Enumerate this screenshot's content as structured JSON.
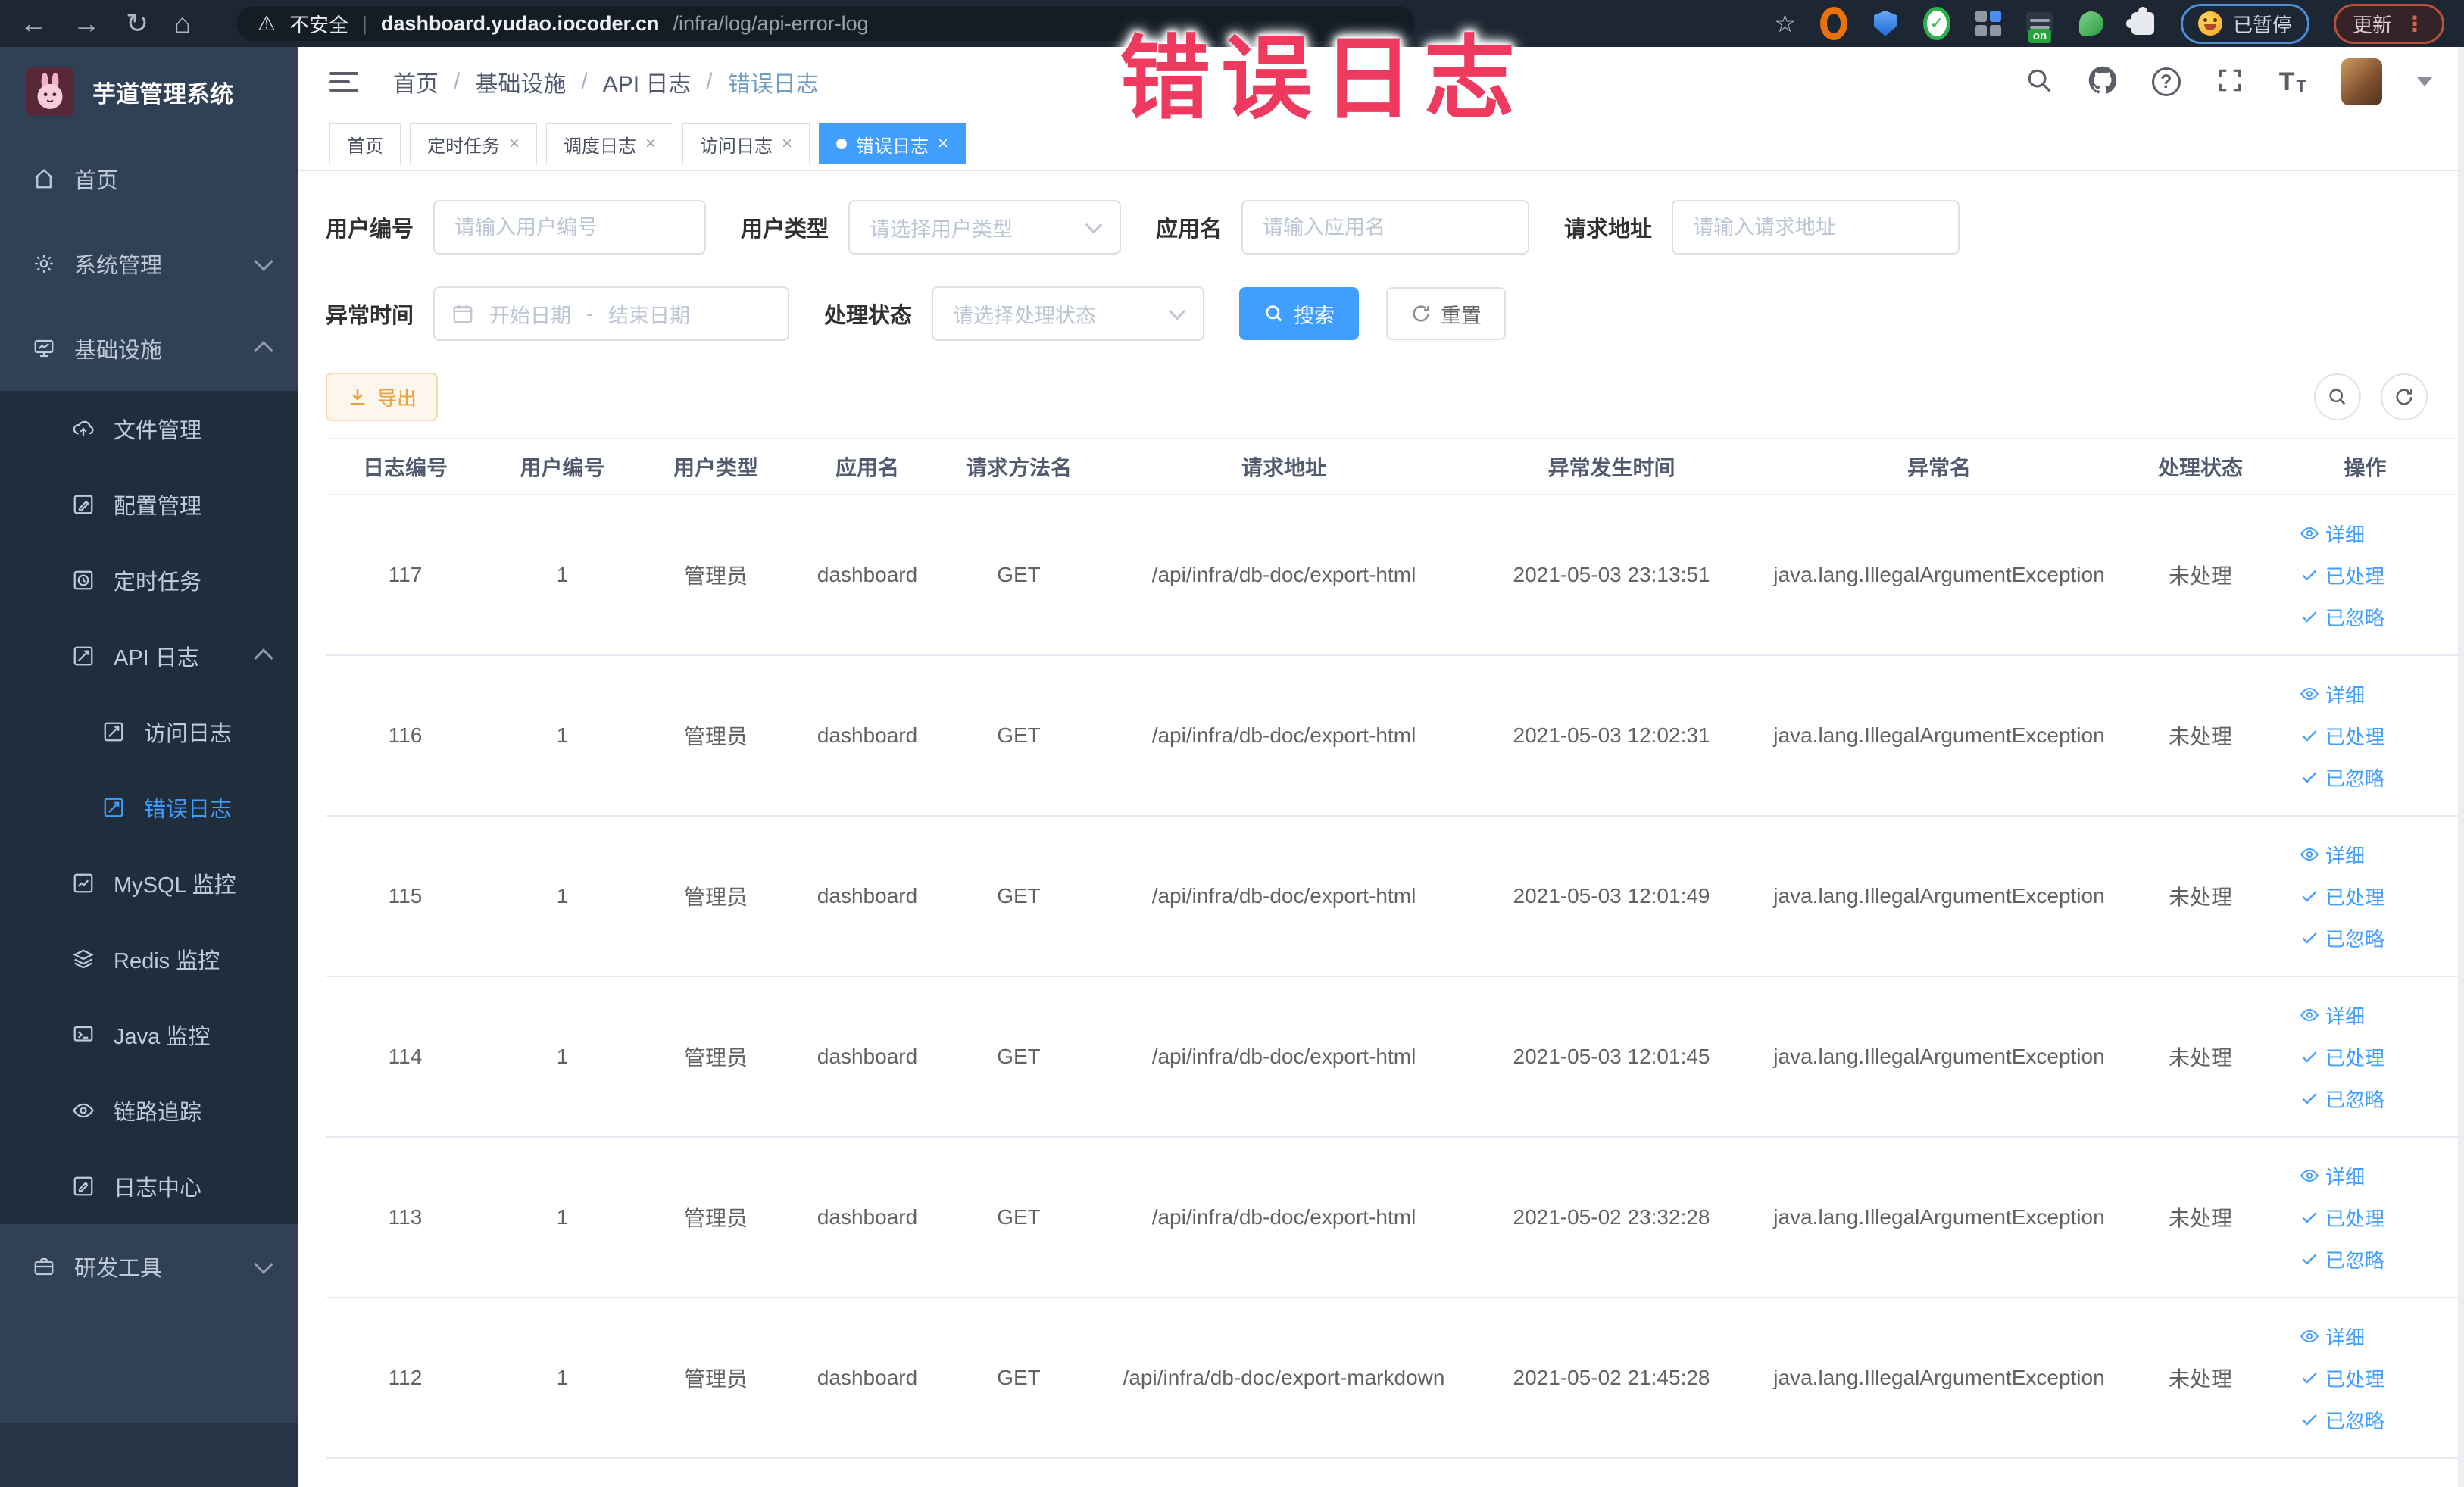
{
  "browser": {
    "security_label": "不安全",
    "url_domain": "dashboard.yudao.iocoder.cn",
    "url_path": "/infra/log/api-error-log",
    "paused_badge": "已暂停",
    "update_label": "更新"
  },
  "overlay_title": "错误日志",
  "ui": {
    "breadcrumb_separator": "/",
    "close_glyph": "×",
    "back_glyph": "←",
    "forward_glyph": "→",
    "reload_glyph": "↻",
    "home_glyph": "⌂",
    "warning_glyph": "⚠",
    "divider_glyph": "|",
    "star_glyph": "☆",
    "kebab_glyph": "⋮",
    "check_glyph": "✓",
    "help_glyph": "?"
  },
  "sidebar": {
    "logo_title": "芋道管理系统",
    "items": {
      "home": "首页",
      "system": "系统管理",
      "infra": "基础设施",
      "file": "文件管理",
      "config": "配置管理",
      "job": "定时任务",
      "apilog": "API 日志",
      "accesslog": "访问日志",
      "errorlog": "错误日志",
      "mysql": "MySQL 监控",
      "redis": "Redis 监控",
      "java": "Java 监控",
      "trace": "链路追踪",
      "logcenter": "日志中心",
      "devtools": "研发工具"
    }
  },
  "breadcrumb": {
    "items": [
      "首页",
      "基础设施",
      "API 日志",
      "错误日志"
    ]
  },
  "tabs": [
    {
      "label": "首页",
      "closable": false,
      "active": false
    },
    {
      "label": "定时任务",
      "closable": true,
      "active": false
    },
    {
      "label": "调度日志",
      "closable": true,
      "active": false
    },
    {
      "label": "访问日志",
      "closable": true,
      "active": false
    },
    {
      "label": "错误日志",
      "closable": true,
      "active": true
    }
  ],
  "filters": {
    "user_id_label": "用户编号",
    "user_id_placeholder": "请输入用户编号",
    "user_type_label": "用户类型",
    "user_type_placeholder": "请选择用户类型",
    "app_name_label": "应用名",
    "app_name_placeholder": "请输入应用名",
    "request_url_label": "请求地址",
    "request_url_placeholder": "请输入请求地址",
    "exception_time_label": "异常时间",
    "date_start_placeholder": "开始日期",
    "date_separator": "-",
    "date_end_placeholder": "结束日期",
    "process_status_label": "处理状态",
    "process_status_placeholder": "请选择处理状态",
    "search_label": "搜索",
    "reset_label": "重置"
  },
  "toolbar": {
    "export_label": "导出"
  },
  "table": {
    "columns": [
      "日志编号",
      "用户编号",
      "用户类型",
      "应用名",
      "请求方法名",
      "请求地址",
      "异常发生时间",
      "异常名",
      "处理状态",
      "操作"
    ],
    "actions": {
      "detail": "详细",
      "processed": "已处理",
      "ignored": "已忽略"
    },
    "rows": [
      {
        "id": "117",
        "user_id": "1",
        "user_type": "管理员",
        "app": "dashboard",
        "method": "GET",
        "url": "/api/infra/db-doc/export-html",
        "time": "2021-05-03 23:13:51",
        "exception": "java.lang.IllegalArgumentException",
        "status": "未处理"
      },
      {
        "id": "116",
        "user_id": "1",
        "user_type": "管理员",
        "app": "dashboard",
        "method": "GET",
        "url": "/api/infra/db-doc/export-html",
        "time": "2021-05-03 12:02:31",
        "exception": "java.lang.IllegalArgumentException",
        "status": "未处理"
      },
      {
        "id": "115",
        "user_id": "1",
        "user_type": "管理员",
        "app": "dashboard",
        "method": "GET",
        "url": "/api/infra/db-doc/export-html",
        "time": "2021-05-03 12:01:49",
        "exception": "java.lang.IllegalArgumentException",
        "status": "未处理"
      },
      {
        "id": "114",
        "user_id": "1",
        "user_type": "管理员",
        "app": "dashboard",
        "method": "GET",
        "url": "/api/infra/db-doc/export-html",
        "time": "2021-05-03 12:01:45",
        "exception": "java.lang.IllegalArgumentException",
        "status": "未处理"
      },
      {
        "id": "113",
        "user_id": "1",
        "user_type": "管理员",
        "app": "dashboard",
        "method": "GET",
        "url": "/api/infra/db-doc/export-html",
        "time": "2021-05-02 23:32:28",
        "exception": "java.lang.IllegalArgumentException",
        "status": "未处理"
      },
      {
        "id": "112",
        "user_id": "1",
        "user_type": "管理员",
        "app": "dashboard",
        "method": "GET",
        "url": "/api/infra/db-doc/export-markdown",
        "time": "2021-05-02 21:45:28",
        "exception": "java.lang.IllegalArgumentException",
        "status": "未处理"
      }
    ]
  }
}
